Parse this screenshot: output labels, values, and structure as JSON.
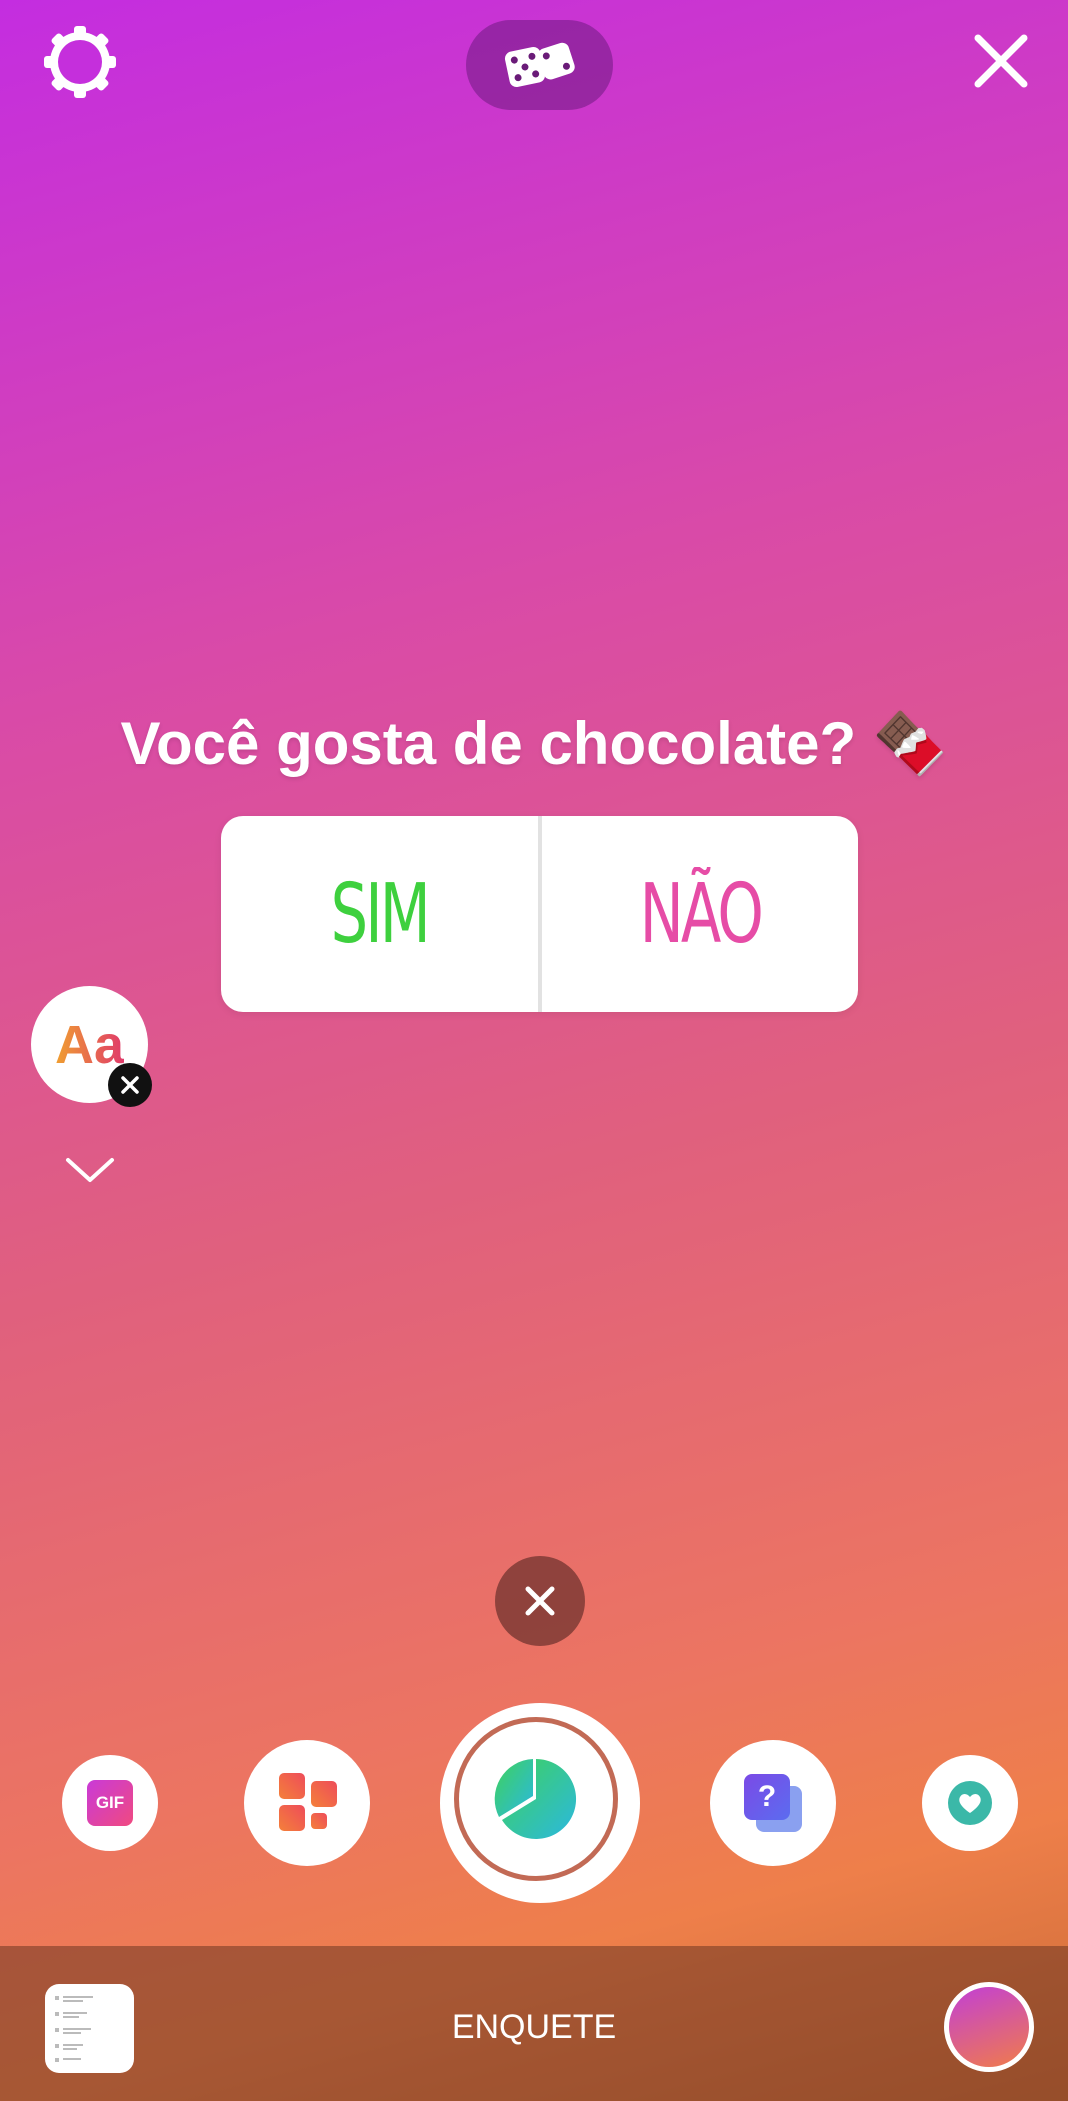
{
  "top_bar": {
    "settings_icon": "gear-icon",
    "random_icon": "dice-icon",
    "close_icon": "close-icon"
  },
  "poll_sticker": {
    "question": "Você gosta de chocolate? 🍫",
    "option_yes": "SIM",
    "option_no": "NÃO",
    "colors": {
      "yes": "#3ed03e",
      "no": "#e64ca6"
    }
  },
  "side_controls": {
    "text_style_label": "Aa"
  },
  "sticker_tray": {
    "items": [
      {
        "icon": "gif-icon",
        "label": "GIF"
      },
      {
        "icon": "grid-icon"
      },
      {
        "icon": "poll-icon",
        "selected": true
      },
      {
        "icon": "question-icon",
        "label": "?"
      },
      {
        "icon": "heart-icon"
      }
    ]
  },
  "bottom_bar": {
    "mode_label": "ENQUETE"
  }
}
